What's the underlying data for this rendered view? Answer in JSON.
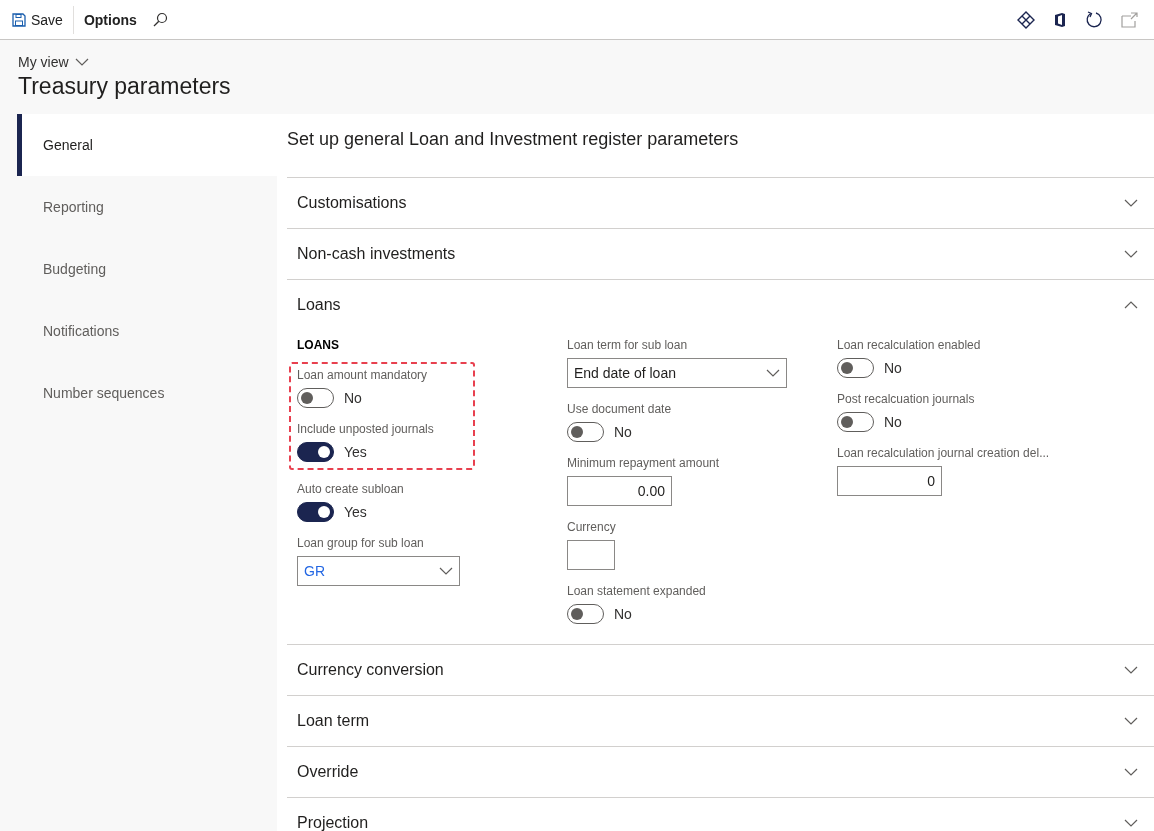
{
  "toolbar": {
    "save": "Save",
    "options": "Options"
  },
  "page": {
    "view": "My view",
    "title": "Treasury parameters"
  },
  "nav": [
    {
      "label": "General",
      "selected": true
    },
    {
      "label": "Reporting",
      "selected": false
    },
    {
      "label": "Budgeting",
      "selected": false
    },
    {
      "label": "Notifications",
      "selected": false
    },
    {
      "label": "Number sequences",
      "selected": false
    }
  ],
  "content": {
    "heading": "Set up general Loan and Investment register parameters",
    "sections": [
      {
        "title": "Customisations",
        "expanded": false
      },
      {
        "title": "Non-cash investments",
        "expanded": false
      },
      {
        "title": "Loans",
        "expanded": true,
        "columns": [
          [
            {
              "kind": "heading",
              "label": "LOANS"
            },
            {
              "kind": "highlight",
              "fields": [
                {
                  "kind": "toggle",
                  "label": "Loan amount mandatory",
                  "on": false,
                  "value": "No"
                },
                {
                  "kind": "toggle",
                  "label": "Include unposted journals",
                  "on": true,
                  "value": "Yes"
                }
              ]
            },
            {
              "kind": "toggle",
              "label": "Auto create subloan",
              "on": true,
              "value": "Yes"
            },
            {
              "kind": "lookup",
              "label": "Loan group for sub loan",
              "value": "GR"
            }
          ],
          [
            {
              "kind": "select",
              "label": "Loan term for sub loan",
              "value": "End date of loan"
            },
            {
              "kind": "toggle",
              "label": "Use document date",
              "on": false,
              "value": "No"
            },
            {
              "kind": "input",
              "label": "Minimum repayment amount",
              "value": "0.00"
            },
            {
              "kind": "short_input",
              "label": "Currency"
            },
            {
              "kind": "toggle",
              "label": "Loan statement expanded",
              "on": false,
              "value": "No"
            }
          ],
          [
            {
              "kind": "toggle",
              "label": "Loan recalculation enabled",
              "on": false,
              "value": "No"
            },
            {
              "kind": "toggle",
              "label": "Post recalcuation journals",
              "on": false,
              "value": "No"
            },
            {
              "kind": "input",
              "label": "Loan recalculation journal creation del...",
              "value": "0"
            }
          ]
        ]
      },
      {
        "title": "Currency conversion",
        "expanded": false
      },
      {
        "title": "Loan term",
        "expanded": false
      },
      {
        "title": "Override",
        "expanded": false
      },
      {
        "title": "Projection",
        "expanded": false
      }
    ]
  }
}
